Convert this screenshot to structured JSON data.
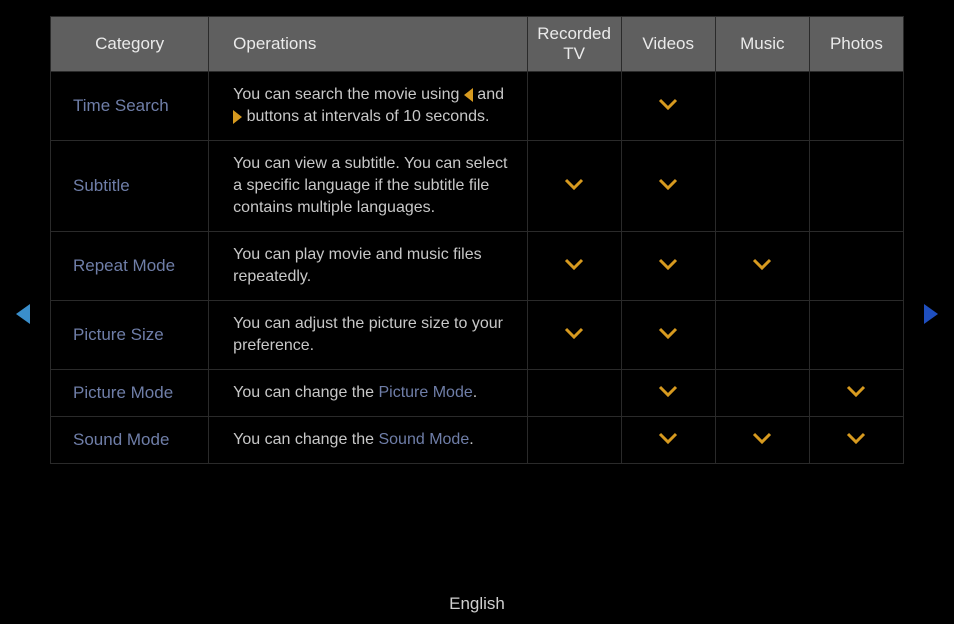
{
  "colors": {
    "accent": "#d79a1f",
    "link": "#6f7ea8",
    "nav_left": "#3a8ecb",
    "nav_right": "#1f4fbf"
  },
  "headers": {
    "category": "Category",
    "operations": "Operations",
    "recorded_tv": "Recorded TV",
    "videos": "Videos",
    "music": "Music",
    "photos": "Photos"
  },
  "rows": [
    {
      "category": "Time Search",
      "op_parts": [
        "You can search the movie using ",
        " and ",
        " buttons at intervals of 10 seconds."
      ],
      "has_arrows": true,
      "recorded_tv": false,
      "videos": true,
      "music": false,
      "photos": false
    },
    {
      "category": "Subtitle",
      "op_parts": [
        "You can view a subtitle. You can select a specific language if the subtitle file contains multiple languages."
      ],
      "recorded_tv": true,
      "videos": true,
      "music": false,
      "photos": false
    },
    {
      "category": "Repeat Mode",
      "op_parts": [
        "You can play movie and music files repeatedly."
      ],
      "recorded_tv": true,
      "videos": true,
      "music": true,
      "photos": false
    },
    {
      "category": "Picture Size",
      "op_parts": [
        "You can adjust the picture size to your preference."
      ],
      "recorded_tv": true,
      "videos": true,
      "music": false,
      "photos": false
    },
    {
      "category": "Picture Mode",
      "op_parts": [
        "You can change the ",
        "Picture Mode",
        "."
      ],
      "has_link": true,
      "recorded_tv": false,
      "videos": true,
      "music": false,
      "photos": true
    },
    {
      "category": "Sound Mode",
      "op_parts": [
        "You can change the ",
        "Sound Mode",
        "."
      ],
      "has_link": true,
      "recorded_tv": false,
      "videos": true,
      "music": true,
      "photos": true
    }
  ],
  "footer": "English"
}
